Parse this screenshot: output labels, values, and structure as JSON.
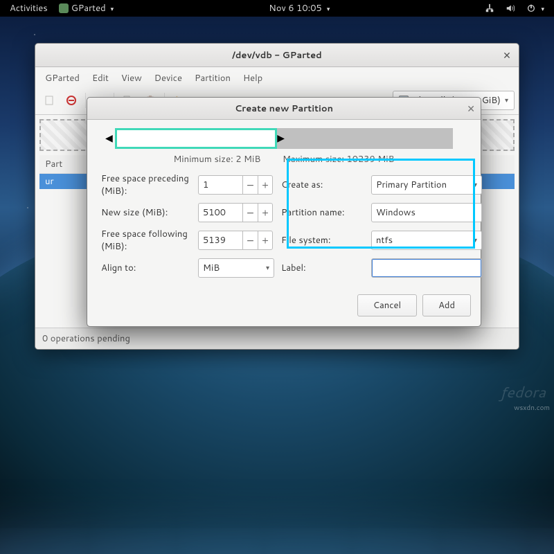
{
  "panel": {
    "activities": "Activities",
    "app": "GParted",
    "clock": "Nov 6  10:05"
  },
  "window": {
    "title": "/dev/vdb - GParted",
    "menus": [
      "GParted",
      "Edit",
      "View",
      "Device",
      "Partition",
      "Help"
    ],
    "device_sel": "/dev/vdb (10.00 GiB)",
    "table_first": "Part",
    "row_first": "ur",
    "status": "0 operations pending"
  },
  "dialog": {
    "title": "Create new Partition",
    "min_label": "Minimum size: 2 MiB",
    "max_label": "Maximum size: 10239 MiB",
    "l_free_pre": "Free space preceding (MiB):",
    "v_free_pre": "1",
    "l_new_size": "New size (MiB):",
    "v_new_size": "5100",
    "l_free_fol": "Free space following (MiB):",
    "v_free_fol": "5139",
    "l_align": "Align to:",
    "v_align": "MiB",
    "l_create": "Create as:",
    "v_create": "Primary Partition",
    "l_pname": "Partition name:",
    "v_pname": "Windows",
    "l_fs": "File system:",
    "v_fs": "ntfs",
    "l_label": "Label:",
    "v_label": "",
    "cancel": "Cancel",
    "add": "Add"
  },
  "watermark": "wsxdn.com",
  "fedora": "fedora"
}
